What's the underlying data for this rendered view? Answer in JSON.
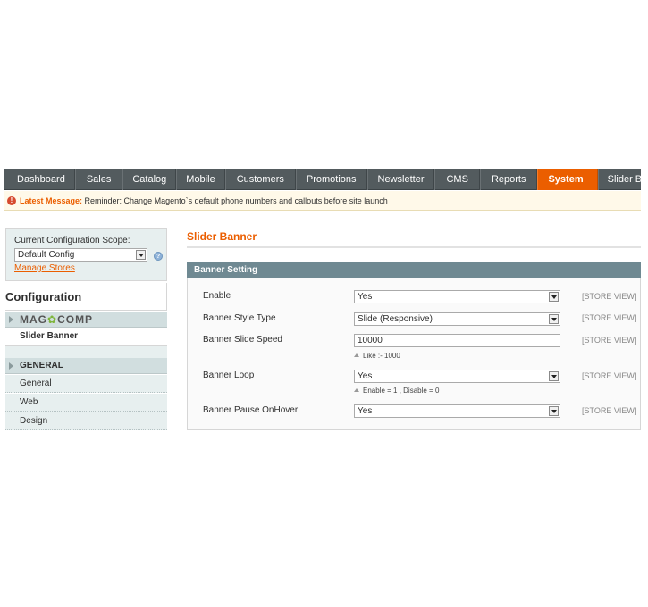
{
  "nav": {
    "items": [
      "Dashboard",
      "Sales",
      "Catalog",
      "Mobile",
      "Customers",
      "Promotions",
      "Newsletter",
      "CMS",
      "Reports",
      "System",
      "Slider Banner"
    ],
    "active": "System"
  },
  "message": {
    "label": "Latest Message:",
    "text": " Reminder: Change Magento`s default phone numbers and callouts before site launch"
  },
  "sidebar": {
    "scope_label": "Current Configuration Scope:",
    "scope_value": "Default Config",
    "manage_stores": "Manage Stores",
    "config_title": "Configuration",
    "vendor_part1": "MAG",
    "vendor_part2": "COMP",
    "vendor_item": "Slider Banner",
    "general_section": "GENERAL",
    "general_items": [
      "General",
      "Web",
      "Design"
    ]
  },
  "main": {
    "page_title": "Slider Banner",
    "fieldset_title": "Banner Setting",
    "fields": [
      {
        "label": "Enable",
        "value": "Yes",
        "scope": "[STORE VIEW]"
      },
      {
        "label": "Banner Style Type",
        "value": "Slide (Responsive)",
        "scope": "[STORE VIEW]"
      },
      {
        "label": "Banner Slide Speed",
        "value": "10000",
        "scope": "[STORE VIEW]",
        "note": "Like :- 1000"
      },
      {
        "label": "Banner Loop",
        "value": "Yes",
        "scope": "[STORE VIEW]",
        "note": "Enable = 1 , Disable = 0"
      },
      {
        "label": "Banner Pause OnHover",
        "value": "Yes",
        "scope": "[STORE VIEW]"
      }
    ]
  },
  "colors": {
    "accent": "#eb5e00",
    "nav_bg": "#535b5e",
    "fieldset_head": "#6f8992"
  }
}
